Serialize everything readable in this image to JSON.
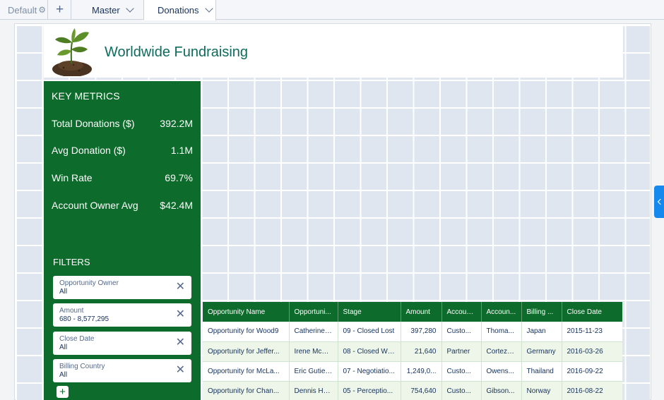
{
  "tabs": {
    "default_label": "Default",
    "add_label": "+",
    "master_label": "Master",
    "donations_label": "Donations"
  },
  "header": {
    "title": "Worldwide Fundraising"
  },
  "metrics": {
    "heading": "KEY METRICS",
    "items": [
      {
        "label": "Total Donations ($)",
        "value": "392.2M"
      },
      {
        "label": "Avg Donation ($)",
        "value": "1.1M"
      },
      {
        "label": "Win Rate",
        "value": "69.7%"
      },
      {
        "label": "Account Owner Avg",
        "value": "$42.4M"
      }
    ]
  },
  "filters": {
    "heading": "FILTERS",
    "items": [
      {
        "label": "Opportunity Owner",
        "value": "All"
      },
      {
        "label": "Amount",
        "value": "680 - 8,577,295"
      },
      {
        "label": "Close Date",
        "value": "All"
      },
      {
        "label": "Billing Country",
        "value": "All"
      }
    ],
    "add_label": "+"
  },
  "table": {
    "columns": [
      "Opportunity Name",
      "Opportuni...",
      "Stage",
      "Amount",
      "Accoun...",
      "Accoun...",
      "Billing ...",
      "Close Date"
    ],
    "rows": [
      [
        "Opportunity for Wood9",
        "Catherine ...",
        "09 - Closed Lost",
        "397,280",
        "Custo...",
        "Thoma...",
        "Japan",
        "2015-11-23"
      ],
      [
        "Opportunity for Jeffer...",
        "Irene McC...",
        "08 - Closed Won",
        "21,640",
        "Partner",
        "Cortez3...",
        "Germany",
        "2016-03-26"
      ],
      [
        "Opportunity for McLa...",
        "Eric Gutier...",
        "07 - Negotiatio...",
        "1,249,0...",
        "Custo...",
        "Owens...",
        "Thailand",
        "2016-09-22"
      ],
      [
        "Opportunity for Chan...",
        "Dennis Ho...",
        "05 - Perceptio...",
        "754,640",
        "Custo...",
        "Gibson...",
        "Norway",
        "2016-08-22"
      ]
    ]
  },
  "colors": {
    "brand_green": "#0d6b2b",
    "title_teal": "#0f6b5c",
    "accent_blue": "#1589ee"
  }
}
